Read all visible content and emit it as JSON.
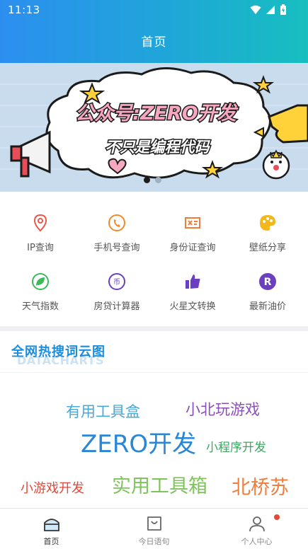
{
  "status_bar": {
    "time": "11:13"
  },
  "header": {
    "title": "首页"
  },
  "banner": {
    "line1": "公众号:ZERO开发",
    "line2": "不只是编程代码",
    "slide_count": 2,
    "active_slide": 1
  },
  "tools": [
    {
      "label": "IP查询",
      "icon": "location-pin-icon",
      "color": "#e8584d"
    },
    {
      "label": "手机号查询",
      "icon": "phone-icon",
      "color": "#f08a2c"
    },
    {
      "label": "身份证查询",
      "icon": "id-card-icon",
      "color": "#f07d3a"
    },
    {
      "label": "壁纸分享",
      "icon": "palette-icon",
      "color": "#f2b81c"
    },
    {
      "label": "天气指数",
      "icon": "leaf-icon",
      "color": "#3cba5a"
    },
    {
      "label": "房贷计算器",
      "icon": "currency-icon",
      "color": "#6a3fc0"
    },
    {
      "label": "火星文转换",
      "icon": "thumbs-up-icon",
      "color": "#6a3fc0"
    },
    {
      "label": "最新油价",
      "icon": "registered-icon",
      "color": "#6a3fc0"
    }
  ],
  "cloud": {
    "title": "全网热搜词云图",
    "subtitle": "DATACHARTS",
    "words": [
      {
        "text": "有用工具盒",
        "color": "#4aa8d8"
      },
      {
        "text": "小北玩游戏",
        "color": "#8a4fb8"
      },
      {
        "text": "ZERO开发",
        "color": "#2a86d6"
      },
      {
        "text": "小程序开发",
        "color": "#3aa860"
      },
      {
        "text": "小游戏开发",
        "color": "#e04a3a"
      },
      {
        "text": "实用工具箱",
        "color": "#7fc35c"
      },
      {
        "text": "北桥苏",
        "color": "#f07d3a"
      }
    ]
  },
  "tabbar": {
    "items": [
      {
        "label": "首页",
        "icon": "home-icon",
        "active": true
      },
      {
        "label": "今日语句",
        "icon": "bag-icon",
        "active": false
      },
      {
        "label": "个人中心",
        "icon": "user-icon",
        "active": false
      }
    ]
  }
}
